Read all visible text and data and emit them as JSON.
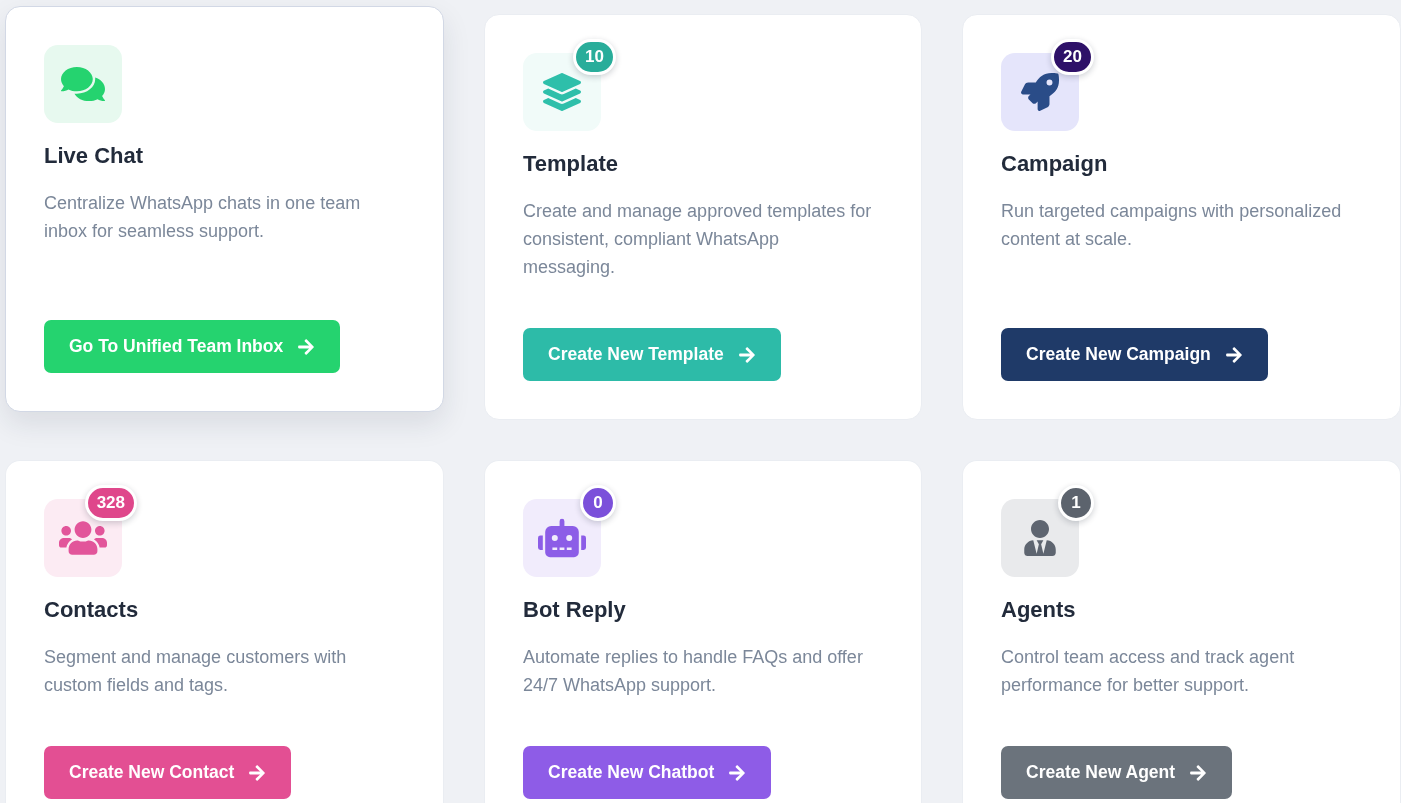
{
  "cards": [
    {
      "kind": "live_chat",
      "hovered": true,
      "title": "Live Chat",
      "description": "Centralize WhatsApp chats in one team inbox for seamless support.",
      "button": "Go To Unified Team Inbox",
      "color": "#25d36f"
    },
    {
      "kind": "template",
      "hovered": false,
      "badge": "10",
      "title": "Template",
      "description": "Create and manage approved templates for consistent, compliant WhatsApp messaging.",
      "button": "Create New Template",
      "color": "#2dbba8"
    },
    {
      "kind": "campaign",
      "hovered": false,
      "badge": "20",
      "title": "Campaign",
      "description": "Run targeted campaigns with personalized content at scale.",
      "button": "Create New Campaign",
      "color": "#1f3a68"
    },
    {
      "kind": "contacts",
      "hovered": false,
      "badge": "328",
      "title": "Contacts",
      "description": "Segment and manage customers with custom fields and tags.",
      "button": "Create New Contact",
      "color": "#e34f93"
    },
    {
      "kind": "bot_reply",
      "hovered": false,
      "badge": "0",
      "title": "Bot Reply",
      "description": "Automate replies to handle FAQs and offer 24/7 WhatsApp support.",
      "button": "Create New Chatbot",
      "color": "#8e5ce7"
    },
    {
      "kind": "agents",
      "hovered": false,
      "badge": "1",
      "title": "Agents",
      "description": "Control team access and track agent performance for better support.",
      "button": "Create New Agent",
      "color": "#6b737c"
    }
  ]
}
